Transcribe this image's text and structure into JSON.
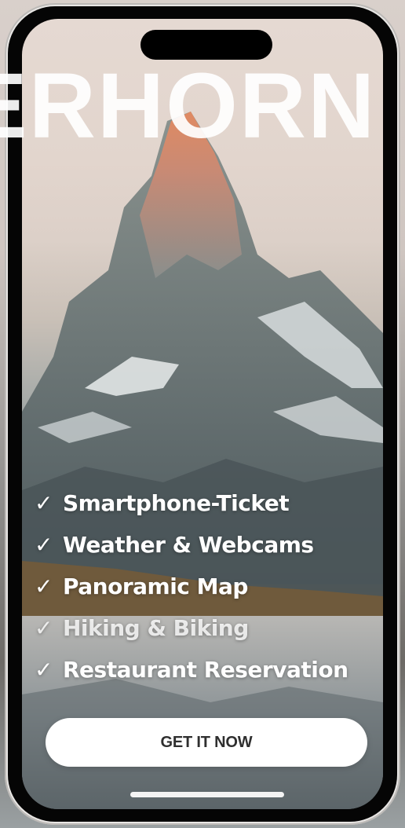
{
  "hero": {
    "title": "ERHORN"
  },
  "features": {
    "items": [
      {
        "check": "✓",
        "label": "Smartphone-Ticket"
      },
      {
        "check": "✓",
        "label": "Weather & Webcams"
      },
      {
        "check": "✓",
        "label": "Panoramic Map"
      },
      {
        "check": "✓",
        "label": "Hiking & Biking"
      },
      {
        "check": "✓",
        "label": "Restaurant Reservation"
      }
    ]
  },
  "cta": {
    "label": "GET IT NOW"
  },
  "colors": {
    "button_bg": "#ffffff",
    "button_text": "#2f2f2f",
    "feature_text": "#ffffff",
    "phone_body": "#050505"
  }
}
